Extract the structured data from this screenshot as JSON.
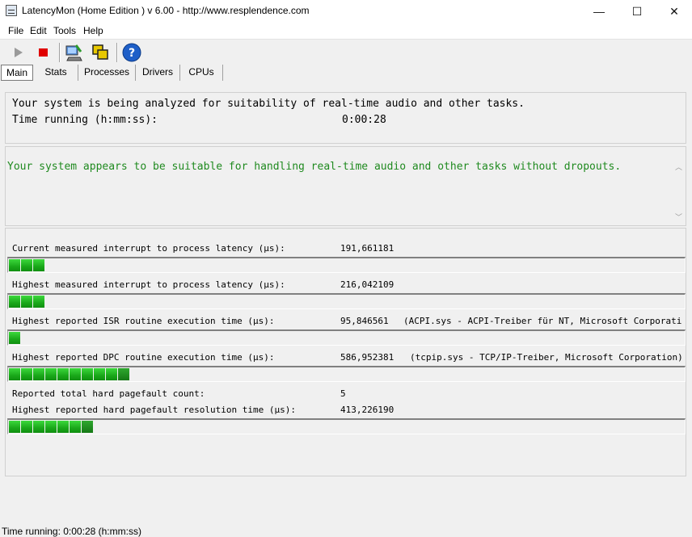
{
  "window": {
    "title": "LatencyMon  (Home Edition )  v 6.00 - http://www.resplendence.com",
    "minimize": "—",
    "maximize": "☐",
    "close": "✕"
  },
  "menu": [
    "File",
    "Edit",
    "Tools",
    "Help"
  ],
  "toolbar": {
    "icons": [
      "play-icon",
      "stop-icon",
      "computer-icon",
      "window-icon",
      "help-icon"
    ]
  },
  "tabs": [
    "Main",
    "Stats",
    "Processes",
    "Drivers",
    "CPUs"
  ],
  "status_panel": {
    "analysis_text": "Your system is being analyzed for suitability of real-time audio and other tasks.",
    "time_label": "Time running (h:mm:ss):",
    "time_value": "0:00:28"
  },
  "result": {
    "message": "Your system appears to be suitable for handling real-time audio and other tasks without dropouts.",
    "color": "#1f8a1f"
  },
  "metrics": [
    {
      "label": "Current measured interrupt to process latency (µs):",
      "value": "191,661181",
      "driver": "",
      "bar_segments": 3
    },
    {
      "label": "Highest measured interrupt to process latency (µs):",
      "value": "216,042109",
      "driver": "",
      "bar_segments": 3
    },
    {
      "label": "Highest reported ISR routine execution time (µs):",
      "value": "95,846561",
      "driver": "(ACPI.sys - ACPI-Treiber für NT, Microsoft Corporation)",
      "bar_segments": 1
    },
    {
      "label": "Highest reported DPC routine execution time (µs):",
      "value": "586,952381",
      "driver": "(tcpip.sys - TCP/IP-Treiber, Microsoft Corporation)",
      "bar_segments": 10
    },
    {
      "label": "Reported total hard pagefault count:",
      "value": "5",
      "driver": "",
      "bar_segments": 0
    },
    {
      "label": "Highest reported hard pagefault resolution time (µs):",
      "value": "413,226190",
      "driver": "",
      "bar_segments": 7
    }
  ],
  "statusbar": {
    "text": "Time running: 0:00:28  (h:mm:ss)"
  }
}
